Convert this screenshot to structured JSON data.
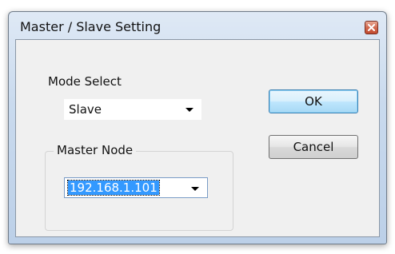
{
  "window": {
    "title": "Master / Slave Setting"
  },
  "mode_select": {
    "label": "Mode Select",
    "value": "Slave"
  },
  "master_node": {
    "group_label": "Master Node",
    "value": "192.168.1.101"
  },
  "buttons": {
    "ok": "OK",
    "cancel": "Cancel"
  },
  "icons": {
    "close": "close-icon",
    "dropdown": "chevron-down-icon"
  }
}
